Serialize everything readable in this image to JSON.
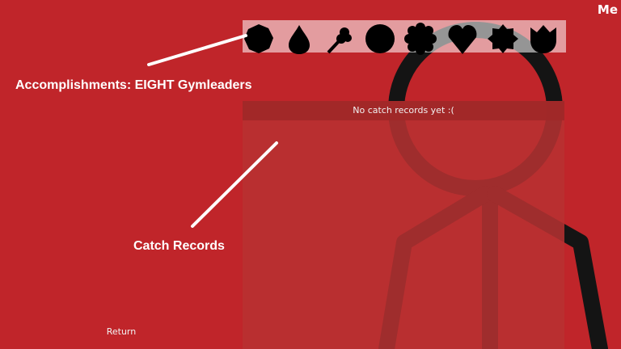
{
  "header": {
    "me_label": "Me"
  },
  "badges": [
    {
      "name": "boulder-badge-icon"
    },
    {
      "name": "cascade-badge-icon"
    },
    {
      "name": "thunder-badge-icon"
    },
    {
      "name": "rainbow-badge-icon"
    },
    {
      "name": "soul-badge-icon"
    },
    {
      "name": "marsh-badge-icon"
    },
    {
      "name": "volcano-badge-icon"
    },
    {
      "name": "earth-badge-icon"
    }
  ],
  "records": {
    "empty_text": "No catch records yet :("
  },
  "annotations": {
    "accomplishments": "Accomplishments: EIGHT Gymleaders",
    "catch_records": "Catch Records"
  },
  "footer": {
    "return_label": "Return"
  },
  "colors": {
    "background": "#c0252a",
    "figure": "#111111"
  }
}
